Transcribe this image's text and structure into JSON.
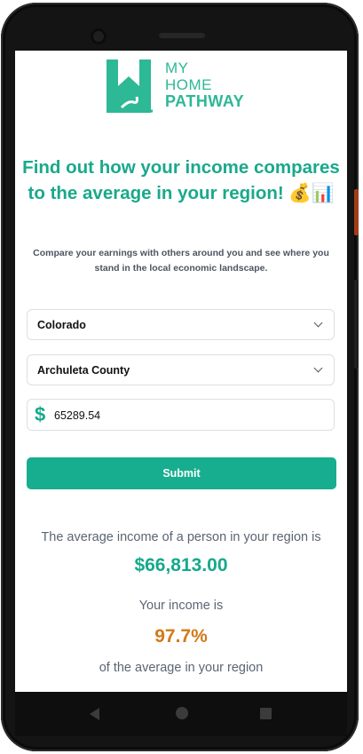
{
  "brand": {
    "line1": "MY",
    "line2": "HOME",
    "line3": "PATHWAY",
    "color": "#2db896"
  },
  "headline": "Find out how your income compares to the average in your region! 💰📊",
  "subtext": "Compare your earnings with others around you and see where you stand in the local economic landscape.",
  "form": {
    "state": "Colorado",
    "county": "Archuleta County",
    "currency_symbol": "$",
    "income_value": "65289.54",
    "submit_label": "Submit"
  },
  "result": {
    "average_label": "The average income of a person in your region is",
    "average_value": "$66,813.00",
    "your_income_label": "Your income is",
    "percent_value": "97.7%",
    "suffix_label": "of the average in your region"
  },
  "colors": {
    "accent": "#16ae8f",
    "percent": "#d27a19"
  },
  "icons": {
    "nav_back": "back-triangle-icon",
    "nav_home": "home-circle-icon",
    "nav_recent": "recent-square-icon"
  }
}
